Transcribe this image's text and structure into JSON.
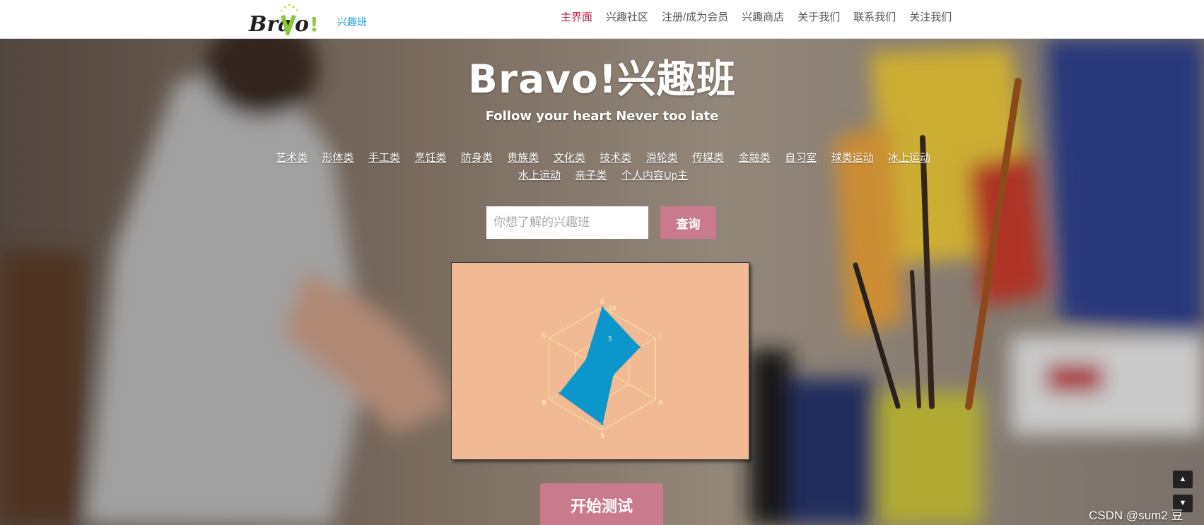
{
  "header": {
    "logo_text": "Bravo!",
    "logo_sub": "兴趣班",
    "nav": [
      {
        "label": "主界面",
        "active": true
      },
      {
        "label": "兴趣社区",
        "active": false
      },
      {
        "label": "注册/成为会员",
        "active": false
      },
      {
        "label": "兴趣商店",
        "active": false
      },
      {
        "label": "关于我们",
        "active": false
      },
      {
        "label": "联系我们",
        "active": false
      },
      {
        "label": "关注我们",
        "active": false
      }
    ]
  },
  "hero": {
    "title": "Bravo!兴趣班",
    "subtitle": "Follow your heart Never too late",
    "categories": [
      "艺术类",
      "形体类",
      "手工类",
      "烹饪类",
      "防身类",
      "贵族类",
      "文化类",
      "技术类",
      "滑轮类",
      "传媒类",
      "金融类",
      "自习室",
      "球类运动",
      "冰上运动",
      "水上运动",
      "亲子类",
      "个人内容Up主"
    ]
  },
  "search": {
    "placeholder": "你想了解的兴趣班",
    "button_label": "查询"
  },
  "chart_data": {
    "type": "radar",
    "axes": [
      "K",
      "I",
      "A",
      "S",
      "B",
      "C"
    ],
    "tick_labels": [
      "5",
      "10"
    ],
    "max": 10,
    "series": [
      {
        "values": [
          10,
          7,
          2,
          9,
          8,
          3
        ]
      }
    ],
    "colors": {
      "fill": "#0b97cc",
      "grid": "#f3e9a6",
      "background": "#f1b994"
    }
  },
  "start_button": "开始测试",
  "scroll": {
    "up_icon": "▲",
    "down_icon": "▼"
  },
  "watermark": "CSDN @sum2 豆"
}
